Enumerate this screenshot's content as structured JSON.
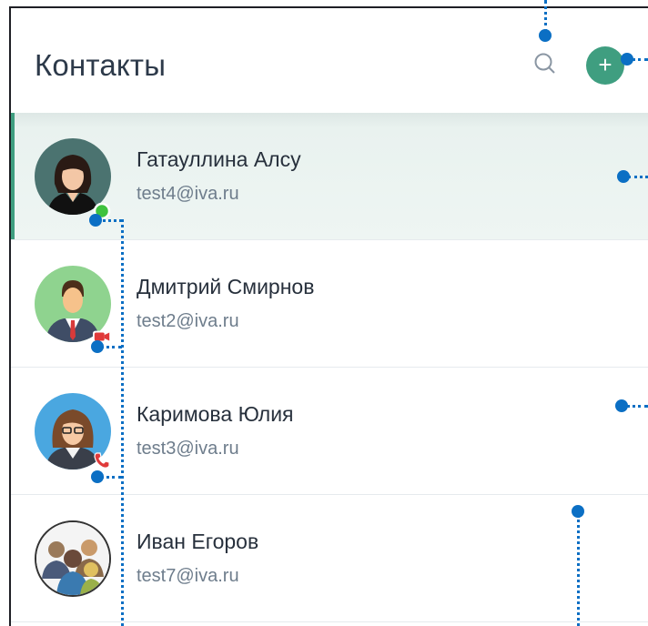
{
  "header": {
    "title": "Контакты",
    "search_icon": "search-icon",
    "add_icon": "plus-icon",
    "add_label": "+"
  },
  "contacts": [
    {
      "name": "Гатауллина Алсу",
      "email": "test4@iva.ru",
      "status": "online",
      "selected": true
    },
    {
      "name": "Дмитрий Смирнов",
      "email": "test2@iva.ru",
      "status": "video-call",
      "selected": false
    },
    {
      "name": "Каримова Юлия",
      "email": "test3@iva.ru",
      "status": "phone-call",
      "selected": false
    },
    {
      "name": "Иван Егоров",
      "email": "test7@iva.ru",
      "status": "none",
      "selected": false
    }
  ],
  "colors": {
    "accent": "#3f9e80",
    "online": "#3fc23f",
    "call": "#e03a3a",
    "annotation": "#0b6fc4"
  }
}
